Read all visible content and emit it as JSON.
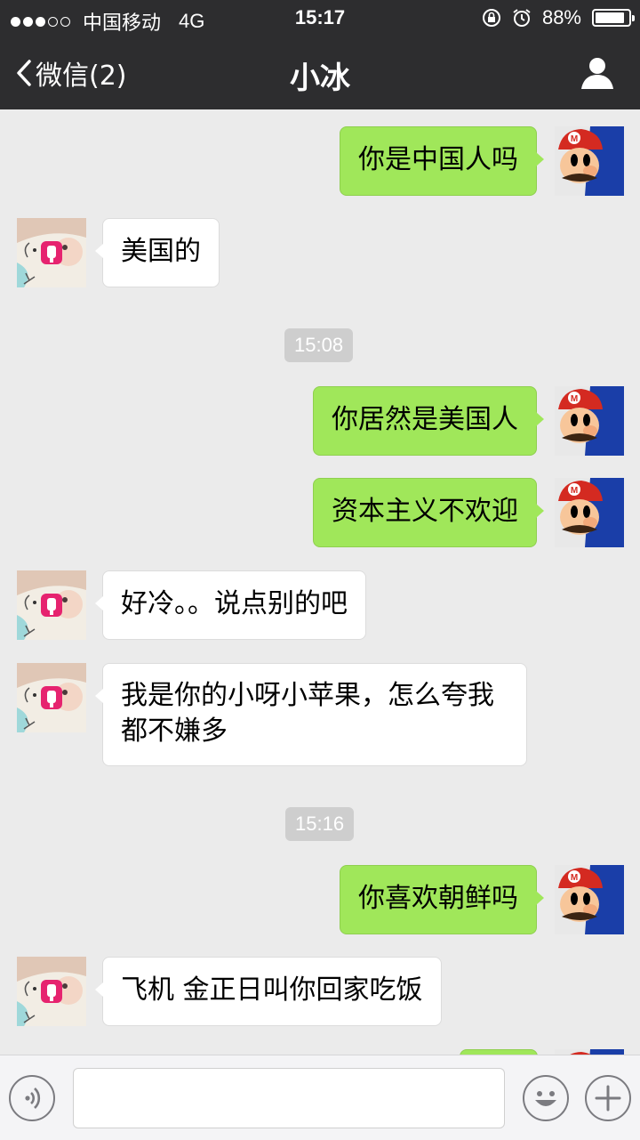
{
  "status_bar": {
    "carrier": "中国移动",
    "network": "4G",
    "time": "15:17",
    "battery_text": "88%",
    "battery_level": 0.88
  },
  "nav": {
    "back_label": "微信(2)",
    "title": "小冰",
    "profile_icon": "person-icon"
  },
  "messages": [
    {
      "side": "out",
      "text": "你是中国人吗"
    },
    {
      "side": "in",
      "text": "美国的"
    },
    {
      "timestamp": "15:08"
    },
    {
      "side": "out",
      "text": "你居然是美国人"
    },
    {
      "side": "out",
      "text": "资本主义不欢迎"
    },
    {
      "side": "in",
      "text": "好冷。。说点别的吧"
    },
    {
      "side": "in",
      "text": "我是你的小呀小苹果，怎么夸我都不嫌多"
    },
    {
      "timestamp": "15:16"
    },
    {
      "side": "out",
      "text": "你喜欢朝鲜吗"
    },
    {
      "side": "in",
      "text": "飞机 金正日叫你回家吃饭"
    },
    {
      "side": "out",
      "text": ""
    }
  ],
  "input_bar": {
    "voice_icon": "voice-icon",
    "emoji_icon": "emoji-icon",
    "plus_icon": "plus-icon",
    "input_value": ""
  },
  "colors": {
    "nav_bg": "#2d2d2f",
    "chat_bg": "#ebebeb",
    "outgoing_bubble": "#a0e75a",
    "incoming_bubble": "#ffffff",
    "timestamp_bg": "#cecece"
  }
}
